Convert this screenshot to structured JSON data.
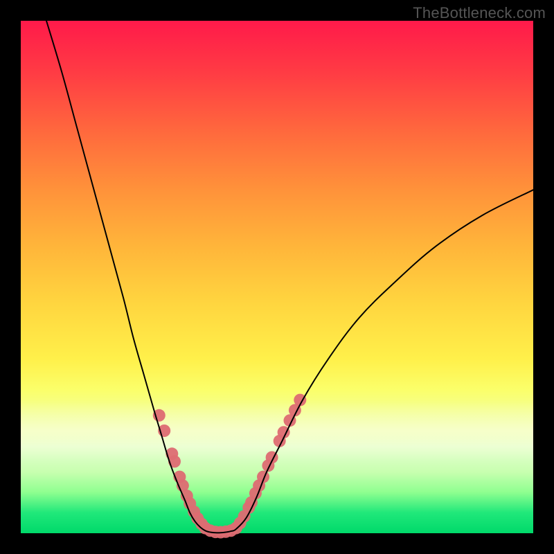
{
  "watermark": "TheBottleneck.com",
  "chart_data": {
    "type": "line",
    "title": "",
    "xlabel": "",
    "ylabel": "",
    "xlim": [
      0,
      100
    ],
    "ylim": [
      0,
      100
    ],
    "grid": false,
    "series": [
      {
        "name": "left-curve",
        "color": "#000000",
        "x": [
          5,
          8,
          11,
          14,
          17,
          20,
          22,
          24,
          26,
          27.5,
          29,
          30.5,
          32,
          33,
          34,
          35,
          36
        ],
        "y": [
          100,
          90,
          79,
          68,
          57,
          46,
          38,
          31,
          24,
          19,
          14,
          10,
          6.5,
          4,
          2.3,
          1.2,
          0.5
        ]
      },
      {
        "name": "flat-valley",
        "color": "#000000",
        "x": [
          36,
          37,
          38,
          39,
          40,
          41,
          42
        ],
        "y": [
          0.5,
          0.2,
          0.1,
          0.1,
          0.2,
          0.4,
          0.8
        ]
      },
      {
        "name": "right-curve",
        "color": "#000000",
        "x": [
          42,
          44,
          46,
          48,
          51,
          55,
          60,
          66,
          73,
          81,
          90,
          100
        ],
        "y": [
          0.8,
          3,
          7,
          12,
          18,
          26,
          34,
          42,
          49,
          56,
          62,
          67
        ]
      }
    ],
    "dot_clusters": [
      {
        "name": "left-cluster",
        "color": "#dd6b72",
        "radius": 9,
        "points": [
          {
            "x": 27.0,
            "y": 23.0
          },
          {
            "x": 28.0,
            "y": 20.0
          },
          {
            "x": 29.5,
            "y": 15.5
          },
          {
            "x": 30.0,
            "y": 14.0
          },
          {
            "x": 31.0,
            "y": 11.0
          },
          {
            "x": 31.6,
            "y": 9.3
          },
          {
            "x": 32.4,
            "y": 7.3
          },
          {
            "x": 33.0,
            "y": 5.8
          },
          {
            "x": 33.8,
            "y": 4.2
          },
          {
            "x": 34.5,
            "y": 2.9
          },
          {
            "x": 35.3,
            "y": 1.8
          },
          {
            "x": 36.0,
            "y": 1.0
          },
          {
            "x": 37.0,
            "y": 0.5
          },
          {
            "x": 38.0,
            "y": 0.25
          },
          {
            "x": 39.0,
            "y": 0.2
          },
          {
            "x": 40.0,
            "y": 0.3
          },
          {
            "x": 41.0,
            "y": 0.5
          }
        ]
      },
      {
        "name": "right-cluster",
        "color": "#dd6b72",
        "radius": 9,
        "points": [
          {
            "x": 42.0,
            "y": 1.0
          },
          {
            "x": 42.8,
            "y": 2.0
          },
          {
            "x": 43.6,
            "y": 3.3
          },
          {
            "x": 44.5,
            "y": 5.0
          },
          {
            "x": 45.0,
            "y": 6.0
          },
          {
            "x": 45.8,
            "y": 7.8
          },
          {
            "x": 46.5,
            "y": 9.3
          },
          {
            "x": 47.3,
            "y": 11.0
          },
          {
            "x": 48.3,
            "y": 13.2
          },
          {
            "x": 49.0,
            "y": 14.8
          },
          {
            "x": 50.5,
            "y": 18.0
          },
          {
            "x": 51.3,
            "y": 19.7
          },
          {
            "x": 52.5,
            "y": 22.0
          },
          {
            "x": 53.5,
            "y": 24.0
          },
          {
            "x": 54.5,
            "y": 26.0
          }
        ]
      }
    ]
  }
}
